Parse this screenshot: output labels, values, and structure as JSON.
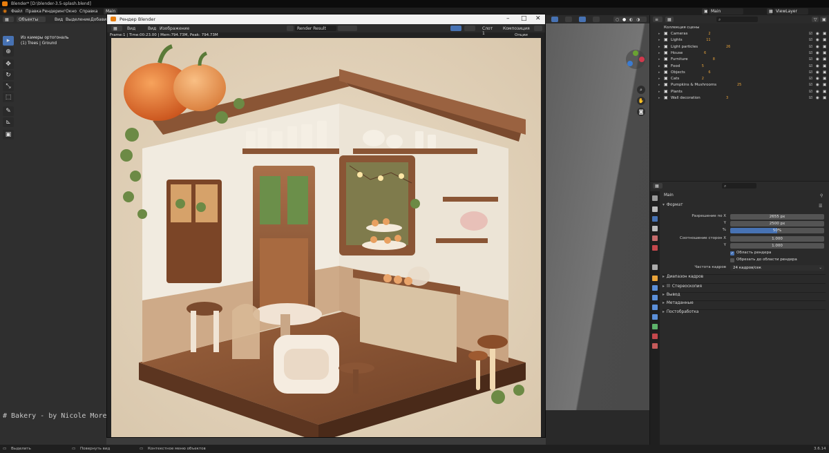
{
  "window": {
    "title": "Blender* [D:\\blender-3.5-splash.blend]"
  },
  "menu": {
    "items": [
      "Файл",
      "Правка",
      "Рендеринг",
      "Окно",
      "Справка"
    ],
    "workspace_tab": "Main",
    "scene_label": "Main",
    "view_layer": "ViewLayer"
  },
  "viewport_header": {
    "mode": "Объекты",
    "items": [
      "Вид",
      "Выделение",
      "Добавить"
    ]
  },
  "viewport": {
    "camera_label": "Из камеры ортогональ",
    "collection_label": "(1) Trees | Ground",
    "overlay_text": "# Bakery - by Nicole Morena h"
  },
  "render_window": {
    "title": "Рендер Blender",
    "header_items": [
      "Вид",
      "Вид",
      "Изображение"
    ],
    "image_name": "Render Result",
    "slot": "Слот 1",
    "composite": "Композиция",
    "options": "Опции",
    "meta": "Frame:1 | Time:00:23.00 | Mem:794.73M, Peak: 794.73M"
  },
  "outliner": {
    "root": "Коллекция сцены",
    "collections": [
      {
        "name": "Cameras",
        "badge": "2"
      },
      {
        "name": "Lights",
        "badge": "11"
      },
      {
        "name": "Light particles",
        "badge": "26"
      },
      {
        "name": "House",
        "badge": "6"
      },
      {
        "name": "Furniture",
        "badge": "8"
      },
      {
        "name": "Food",
        "badge": "5"
      },
      {
        "name": "Objects",
        "badge": "6"
      },
      {
        "name": "Cats",
        "badge": "2"
      },
      {
        "name": "Pumpkins & Mushrooms",
        "badge": "25"
      },
      {
        "name": "Plants",
        "badge": ""
      },
      {
        "name": "Wall decoration",
        "badge": "3"
      }
    ]
  },
  "properties": {
    "context": "Main",
    "format_panel": "Формат",
    "res_x_label": "Разрешение по X",
    "res_x": "2655 px",
    "res_y_label": "Y",
    "res_y": "2500 px",
    "percent_label": "%",
    "percent": "50%",
    "percent_fill": 0.5,
    "aspect_x_label": "Соотношение сторон X",
    "aspect_x": "1.000",
    "aspect_y_label": "Y",
    "aspect_y": "1.000",
    "render_region": "Область рендера",
    "crop_region": "Обрезать до области рендера",
    "fps_label": "Частота кадров",
    "fps": "24 кадров/сек",
    "panels": [
      "Диапазон кадров",
      "Стереоскопия",
      "Вывод",
      "Метаданные",
      "Постобработка"
    ]
  },
  "status_bar": {
    "select": "Выделить",
    "rotate": "Повернуть вид",
    "context_menu": "Контекстное меню объектов",
    "version": "3.6.14"
  },
  "colors": {
    "accent": "#4772b3",
    "orange": "#e87d0d",
    "panel_bg": "#2a2a2a"
  }
}
